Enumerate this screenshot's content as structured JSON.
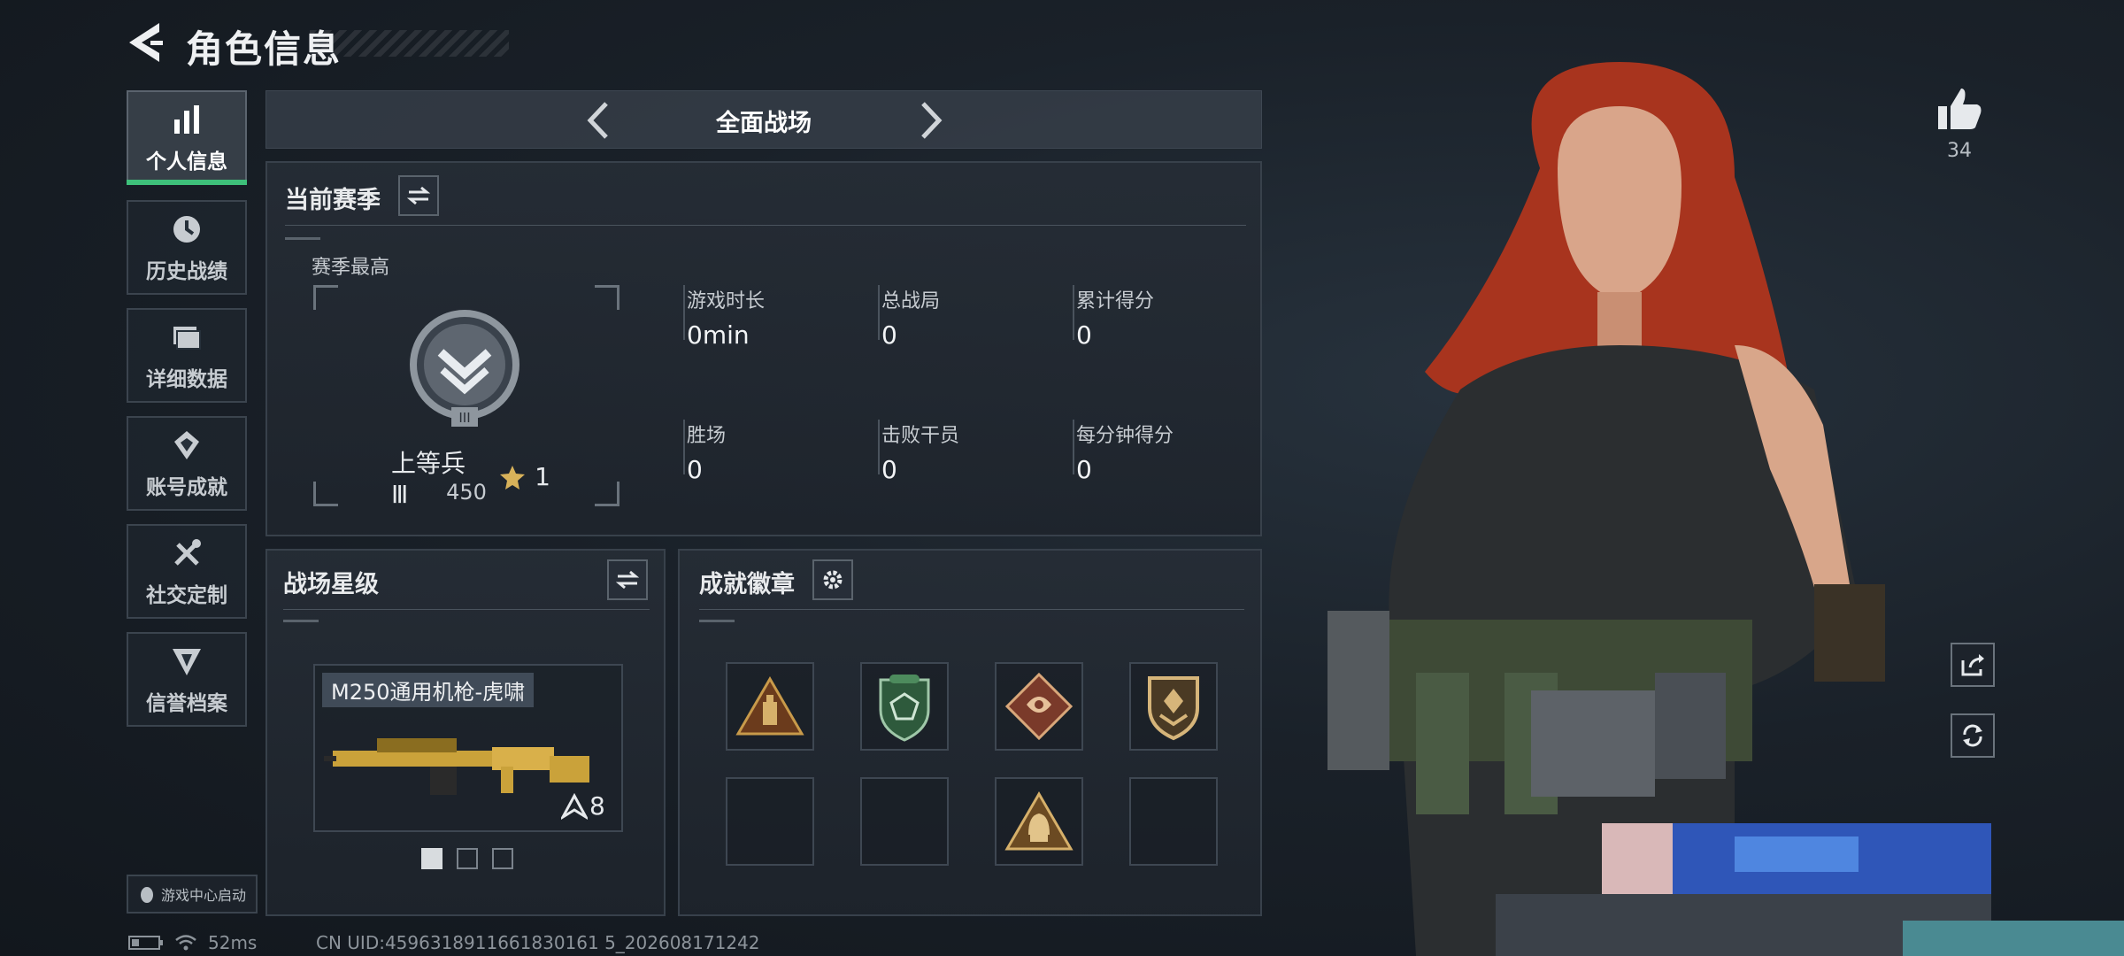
{
  "header": {
    "title": "角色信息"
  },
  "sidebar": {
    "items": [
      {
        "label": "个人信息",
        "icon": "bar-chart-icon",
        "active": true
      },
      {
        "label": "历史战绩",
        "icon": "history-icon",
        "active": false
      },
      {
        "label": "详细数据",
        "icon": "folder-icon",
        "active": false
      },
      {
        "label": "账号成就",
        "icon": "achievement-icon",
        "active": false
      },
      {
        "label": "社交定制",
        "icon": "tools-icon",
        "active": false
      },
      {
        "label": "信誉档案",
        "icon": "reputation-icon",
        "active": false
      }
    ],
    "launch_label": "游戏中心启动"
  },
  "status": {
    "ping": "52ms",
    "uid": "CN UID:4596318911661830161 5_202608171242"
  },
  "mode": {
    "title": "全面战场"
  },
  "season": {
    "title": "当前赛季",
    "best_label": "赛季最高",
    "rank_name": "上等兵 Ⅲ",
    "rank_stars": "1",
    "rank_score": "450",
    "rank_numeral": "III",
    "stats": [
      {
        "label": "游戏时长",
        "value": "0min"
      },
      {
        "label": "总战局",
        "value": "0"
      },
      {
        "label": "累计得分",
        "value": "0"
      },
      {
        "label": "胜场",
        "value": "0"
      },
      {
        "label": "击败干员",
        "value": "0"
      },
      {
        "label": "每分钟得分",
        "value": "0"
      }
    ]
  },
  "star_level": {
    "title": "战场星级",
    "weapon_name": "M250通用机枪-虎啸",
    "weapon_level": "8"
  },
  "badges": {
    "title": "成就徽章",
    "slots": [
      {
        "icon": "ammo-triangle-badge-icon",
        "filled": true
      },
      {
        "icon": "green-shield-badge-icon",
        "filled": true
      },
      {
        "icon": "dragon-diamond-badge-icon",
        "filled": true
      },
      {
        "icon": "gold-shield-badge-icon",
        "filled": true
      },
      {
        "icon": "",
        "filled": false
      },
      {
        "icon": "",
        "filled": false
      },
      {
        "icon": "helmet-triangle-badge-icon",
        "filled": true
      },
      {
        "icon": "",
        "filled": false
      }
    ]
  },
  "likes": {
    "count": "34"
  },
  "colors": {
    "accent_green": "#3ec07a",
    "panel_border": "#38414b"
  }
}
